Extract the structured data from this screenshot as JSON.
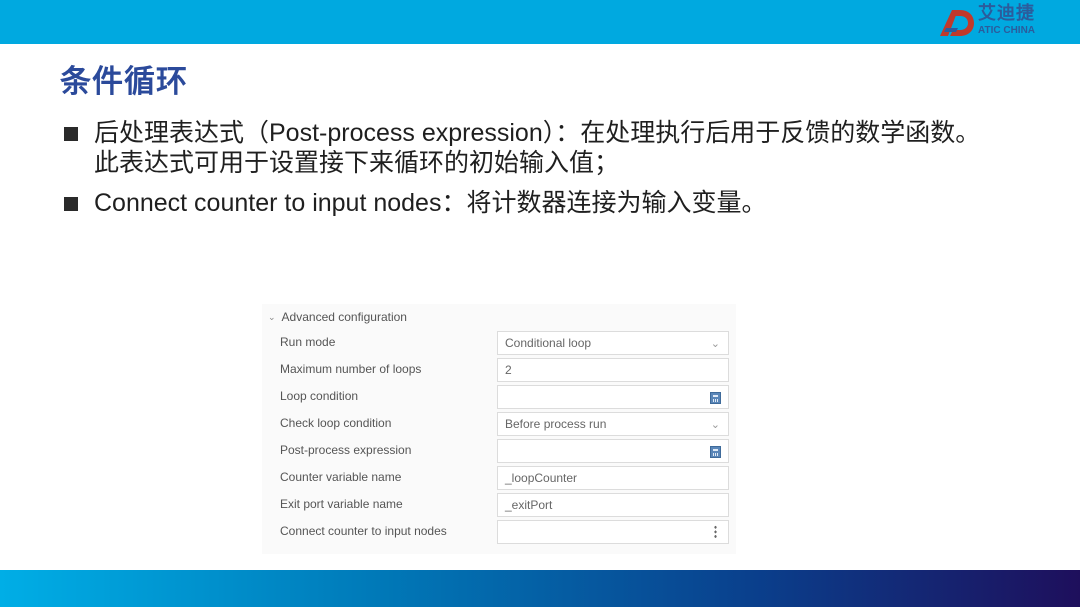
{
  "header": {
    "brand_color": "#00a9e0",
    "logo": {
      "name_cn": "艾迪捷",
      "name_en": "ATIC CHINA",
      "mark_icon": "ad-logo-icon"
    }
  },
  "slide": {
    "title": "条件循环",
    "title_color": "#2b4a9b",
    "bullets": [
      {
        "text": "后处理表达式（Post-process expression）：在处理执行后用于反馈的数学函数。此表达式可用于设置接下来循环的初始输入值；"
      },
      {
        "text": "Connect counter to input nodes：将计数器连接为输入变量。"
      }
    ]
  },
  "config_panel": {
    "section_title": "Advanced configuration",
    "section_icon": "chevron-down-icon",
    "rows": [
      {
        "label": "Run mode",
        "value": "Conditional loop",
        "type": "select",
        "icon": "chevron-down-icon"
      },
      {
        "label": "Maximum number of loops",
        "value": "2",
        "type": "input",
        "icon": ""
      },
      {
        "label": "Loop condition",
        "value": "",
        "type": "expression",
        "icon": "calculator-icon"
      },
      {
        "label": "Check loop condition",
        "value": "Before process run",
        "type": "select",
        "icon": "chevron-down-icon"
      },
      {
        "label": "Post-process expression",
        "value": "",
        "type": "expression",
        "icon": "calculator-icon"
      },
      {
        "label": "Counter variable name",
        "value": "_loopCounter",
        "type": "input",
        "icon": ""
      },
      {
        "label": "Exit port variable name",
        "value": "_exitPort",
        "type": "input",
        "icon": ""
      },
      {
        "label": "Connect counter to input nodes",
        "value": "",
        "type": "menu",
        "icon": "more-vertical-icon"
      }
    ]
  },
  "footer": {
    "gradient_start": "#00aee6",
    "gradient_end": "#1e0f5c"
  }
}
